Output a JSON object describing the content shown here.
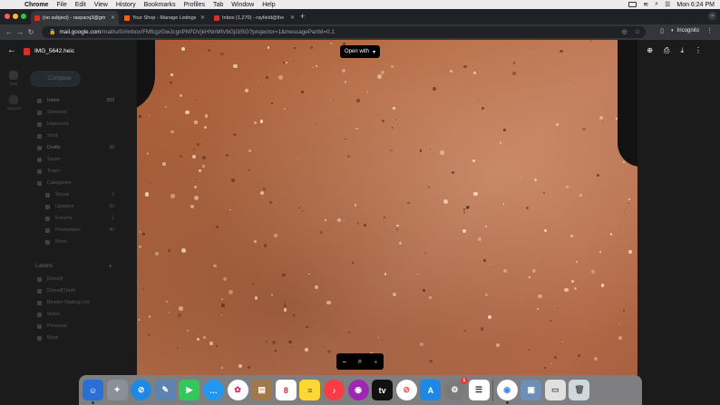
{
  "menubar": {
    "app": "Chrome",
    "items": [
      "File",
      "Edit",
      "View",
      "History",
      "Bookmarks",
      "Profiles",
      "Tab",
      "Window",
      "Help"
    ],
    "clock": "Mon 6:24 PM"
  },
  "tabs": [
    {
      "title": "(no subject) - ravpacq3@gm",
      "favicon_color": "#d93025",
      "active": true
    },
    {
      "title": "Your Shop - Manage Listings",
      "favicon_color": "#f56400",
      "active": false
    },
    {
      "title": "Inbox (1,270) - rayfield@the",
      "favicon_color": "#d93025",
      "active": false
    }
  ],
  "toolbar": {
    "url_host": "mail.google.com",
    "url_path": "/mail/u/0/#inbox/FMfcgzGwJcgnPhPDVjkHNnMtVbGjGlSG?projector=1&messagePartId=0.1",
    "profile_label": "Incognito"
  },
  "gmail": {
    "compose": "Compose",
    "rail": [
      "Mail",
      "Spaces"
    ],
    "folders": [
      {
        "label": "Inbox",
        "count": "269"
      },
      {
        "label": "Snoozed",
        "count": ""
      },
      {
        "label": "Important",
        "count": ""
      },
      {
        "label": "Sent",
        "count": ""
      },
      {
        "label": "Drafts",
        "count": "10"
      },
      {
        "label": "Spam",
        "count": ""
      },
      {
        "label": "Trash",
        "count": ""
      },
      {
        "label": "Categories",
        "count": ""
      },
      {
        "label": "Social",
        "count": "2"
      },
      {
        "label": "Updates",
        "count": "90"
      },
      {
        "label": "Forums",
        "count": "1"
      },
      {
        "label": "Promotions",
        "count": "40"
      },
      {
        "label": "More",
        "count": ""
      }
    ],
    "labels_heading": "Labels",
    "labels": [
      "[Gmail]",
      "[Gmail]Trash",
      "Beader Mailing List",
      "Notes",
      "Personal",
      "More"
    ]
  },
  "viewer": {
    "file_name": "IMG_5642.heic",
    "open_with": "Open with",
    "zoom_out": "−",
    "zoom_in": "+"
  },
  "dock": {
    "mail_badge": "1"
  }
}
